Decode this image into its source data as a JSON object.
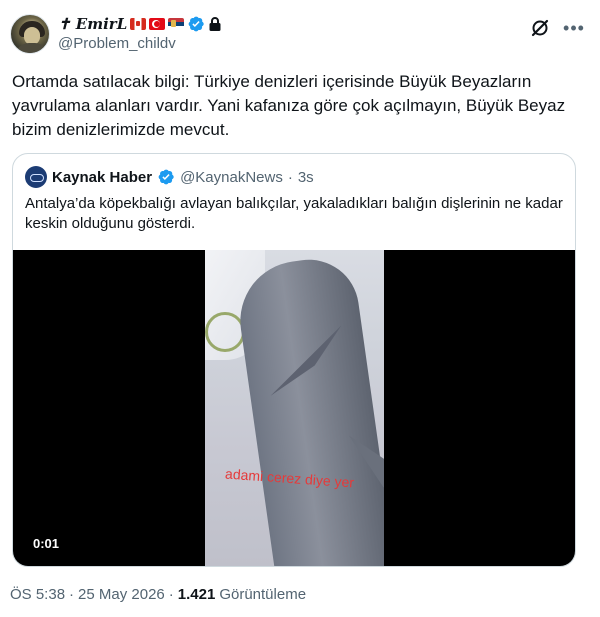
{
  "author": {
    "display_name": "✝ EmirL",
    "handle": "@Problem_childv",
    "flags": [
      "canada-flag",
      "turkey-flag",
      "serbia-flag"
    ],
    "verified": true,
    "protected": true
  },
  "tweet": {
    "text": "Ortamda satılacak bilgi: Türkiye denizleri içerisinde Büyük Beyazların yavrulama alanları vardır. Yani kafanıza göre çok açılmayın, Büyük Beyaz bizim denizlerimizde mevcut."
  },
  "quoted": {
    "name": "Kaynak Haber",
    "handle": "@KaynakNews",
    "separator": "·",
    "time": "3s",
    "text": "Antalya’da köpekbalığı avlayan balıkçılar, yakaladıkları balığın dişlerinin ne kadar keskin olduğunu gösterdi.",
    "video": {
      "caption": "adami cerez diye yer",
      "duration": "0:01"
    }
  },
  "meta": {
    "time": "ÖS 5:38",
    "sep1": "·",
    "date": "25 May 2026",
    "sep2": "·",
    "views": "1.421",
    "views_label": "Görüntüleme"
  },
  "colors": {
    "verified_blue": "#1d9bf0",
    "text_primary": "#0f1419",
    "text_secondary": "#536471",
    "border": "#cfd9de"
  }
}
